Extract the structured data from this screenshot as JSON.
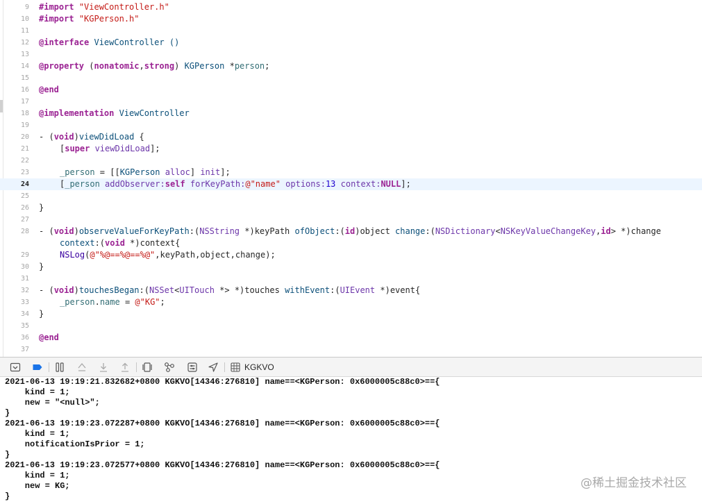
{
  "editor": {
    "lines": [
      {
        "num": "9",
        "indent": 0,
        "tokens": [
          {
            "t": "#import ",
            "c": "kw"
          },
          {
            "t": "\"ViewController.h\"",
            "c": "str"
          }
        ]
      },
      {
        "num": "10",
        "indent": 0,
        "tokens": [
          {
            "t": "#import ",
            "c": "kw"
          },
          {
            "t": "\"KGPerson.h\"",
            "c": "str"
          }
        ]
      },
      {
        "num": "11",
        "indent": 0,
        "tokens": []
      },
      {
        "num": "12",
        "indent": 0,
        "tokens": [
          {
            "t": "@interface",
            "c": "kw"
          },
          {
            "t": " ViewController ()",
            "c": "type"
          }
        ]
      },
      {
        "num": "13",
        "indent": 0,
        "tokens": []
      },
      {
        "num": "14",
        "indent": 0,
        "tokens": [
          {
            "t": "@property",
            "c": "kw"
          },
          {
            "t": " (",
            "c": "pl"
          },
          {
            "t": "nonatomic",
            "c": "kw"
          },
          {
            "t": ",",
            "c": "pl"
          },
          {
            "t": "strong",
            "c": "kw"
          },
          {
            "t": ") ",
            "c": "pl"
          },
          {
            "t": "KGPerson",
            "c": "type"
          },
          {
            "t": " *",
            "c": "pl"
          },
          {
            "t": "person",
            "c": "prop"
          },
          {
            "t": ";",
            "c": "pl"
          }
        ]
      },
      {
        "num": "15",
        "indent": 0,
        "tokens": []
      },
      {
        "num": "16",
        "indent": 0,
        "tokens": [
          {
            "t": "@end",
            "c": "kw"
          }
        ]
      },
      {
        "num": "17",
        "indent": 0,
        "tokens": []
      },
      {
        "num": "18",
        "indent": 0,
        "tokens": [
          {
            "t": "@implementation",
            "c": "kw"
          },
          {
            "t": " ViewController",
            "c": "type"
          }
        ]
      },
      {
        "num": "19",
        "indent": 0,
        "tokens": []
      },
      {
        "num": "20",
        "indent": 0,
        "tokens": [
          {
            "t": "- (",
            "c": "pl"
          },
          {
            "t": "void",
            "c": "kw"
          },
          {
            "t": ")",
            "c": "pl"
          },
          {
            "t": "viewDidLoad",
            "c": "type"
          },
          {
            "t": " {",
            "c": "pl"
          }
        ]
      },
      {
        "num": "21",
        "indent": 1,
        "tokens": [
          {
            "t": "[",
            "c": "pl"
          },
          {
            "t": "super",
            "c": "kw"
          },
          {
            "t": " viewDidLoad",
            "c": "meth"
          },
          {
            "t": "];",
            "c": "pl"
          }
        ]
      },
      {
        "num": "22",
        "indent": 0,
        "tokens": []
      },
      {
        "num": "23",
        "indent": 1,
        "tokens": [
          {
            "t": "_person",
            "c": "prop"
          },
          {
            "t": " = [[",
            "c": "pl"
          },
          {
            "t": "KGPerson",
            "c": "type"
          },
          {
            "t": " alloc",
            "c": "meth"
          },
          {
            "t": "] ",
            "c": "pl"
          },
          {
            "t": "init",
            "c": "meth"
          },
          {
            "t": "];",
            "c": "pl"
          }
        ]
      },
      {
        "num": "24",
        "indent": 1,
        "current": true,
        "tokens": [
          {
            "t": "[",
            "c": "pl"
          },
          {
            "t": "_person",
            "c": "prop"
          },
          {
            "t": " addObserver:",
            "c": "meth"
          },
          {
            "t": "self",
            "c": "kw"
          },
          {
            "t": " forKeyPath:",
            "c": "meth"
          },
          {
            "t": "@\"name\"",
            "c": "str"
          },
          {
            "t": " options:",
            "c": "meth"
          },
          {
            "t": "13",
            "c": "num"
          },
          {
            "t": " context:",
            "c": "meth"
          },
          {
            "t": "NULL",
            "c": "kw"
          },
          {
            "t": "];",
            "c": "pl"
          }
        ]
      },
      {
        "num": "25",
        "indent": 0,
        "tokens": []
      },
      {
        "num": "26",
        "indent": 0,
        "tokens": [
          {
            "t": "}",
            "c": "pl"
          }
        ]
      },
      {
        "num": "27",
        "indent": 0,
        "tokens": []
      },
      {
        "num": "28",
        "indent": 0,
        "tokens": [
          {
            "t": "- (",
            "c": "pl"
          },
          {
            "t": "void",
            "c": "kw"
          },
          {
            "t": ")",
            "c": "pl"
          },
          {
            "t": "observeValueForKeyPath",
            "c": "type"
          },
          {
            "t": ":(",
            "c": "pl"
          },
          {
            "t": "NSString",
            "c": "meth"
          },
          {
            "t": " *)keyPath ",
            "c": "pl"
          },
          {
            "t": "ofObject",
            "c": "type"
          },
          {
            "t": ":(",
            "c": "pl"
          },
          {
            "t": "id",
            "c": "kw"
          },
          {
            "t": ")object ",
            "c": "pl"
          },
          {
            "t": "change",
            "c": "type"
          },
          {
            "t": ":(",
            "c": "pl"
          },
          {
            "t": "NSDictionary",
            "c": "meth"
          },
          {
            "t": "<",
            "c": "pl"
          },
          {
            "t": "NSKeyValueChangeKey",
            "c": "meth"
          },
          {
            "t": ",",
            "c": "pl"
          },
          {
            "t": "id",
            "c": "kw"
          },
          {
            "t": "> *)change",
            "c": "pl"
          }
        ]
      },
      {
        "num": "",
        "indent": 1,
        "tokens": [
          {
            "t": "context",
            "c": "type"
          },
          {
            "t": ":(",
            "c": "pl"
          },
          {
            "t": "void",
            "c": "kw"
          },
          {
            "t": " *)context{",
            "c": "pl"
          }
        ]
      },
      {
        "num": "29",
        "indent": 1,
        "tokens": [
          {
            "t": "NSLog",
            "c": "nsl"
          },
          {
            "t": "(",
            "c": "pl"
          },
          {
            "t": "@\"%@==%@==%@\"",
            "c": "str"
          },
          {
            "t": ",keyPath,object,change);",
            "c": "pl"
          }
        ]
      },
      {
        "num": "30",
        "indent": 0,
        "tokens": [
          {
            "t": "}",
            "c": "pl"
          }
        ]
      },
      {
        "num": "31",
        "indent": 0,
        "tokens": []
      },
      {
        "num": "32",
        "indent": 0,
        "tokens": [
          {
            "t": "- (",
            "c": "pl"
          },
          {
            "t": "void",
            "c": "kw"
          },
          {
            "t": ")",
            "c": "pl"
          },
          {
            "t": "touchesBegan",
            "c": "type"
          },
          {
            "t": ":(",
            "c": "pl"
          },
          {
            "t": "NSSet",
            "c": "meth"
          },
          {
            "t": "<",
            "c": "pl"
          },
          {
            "t": "UITouch",
            "c": "meth"
          },
          {
            "t": " *> *)touches ",
            "c": "pl"
          },
          {
            "t": "withEvent",
            "c": "type"
          },
          {
            "t": ":(",
            "c": "pl"
          },
          {
            "t": "UIEvent",
            "c": "meth"
          },
          {
            "t": " *)event{",
            "c": "pl"
          }
        ]
      },
      {
        "num": "33",
        "indent": 1,
        "tokens": [
          {
            "t": "_person",
            "c": "prop"
          },
          {
            "t": ".",
            "c": "pl"
          },
          {
            "t": "name",
            "c": "prop"
          },
          {
            "t": " = ",
            "c": "pl"
          },
          {
            "t": "@\"KG\"",
            "c": "str"
          },
          {
            "t": ";",
            "c": "pl"
          }
        ]
      },
      {
        "num": "34",
        "indent": 0,
        "tokens": [
          {
            "t": "}",
            "c": "pl"
          }
        ]
      },
      {
        "num": "35",
        "indent": 0,
        "tokens": []
      },
      {
        "num": "36",
        "indent": 0,
        "tokens": [
          {
            "t": "@end",
            "c": "kw"
          }
        ]
      },
      {
        "num": "37",
        "indent": 0,
        "tokens": []
      }
    ]
  },
  "debug_bar": {
    "process_label": "KGKVO",
    "buttons": [
      "hide-debug-area-icon",
      "breakpoints-toggle-icon",
      "pause-icon",
      "step-over-icon",
      "step-into-icon",
      "step-out-icon",
      "view-debugger-icon",
      "memory-graph-icon",
      "environment-overrides-icon",
      "simulate-location-icon",
      "process-icon"
    ]
  },
  "console": {
    "lines": [
      "2021-06-13 19:19:21.832682+0800 KGKVO[14346:276810] name==<KGPerson: 0x6000005c88c0>=={",
      "    kind = 1;",
      "    new = \"<null>\";",
      "}",
      "2021-06-13 19:19:23.072287+0800 KGKVO[14346:276810] name==<KGPerson: 0x6000005c88c0>=={",
      "    kind = 1;",
      "    notificationIsPrior = 1;",
      "}",
      "2021-06-13 19:19:23.072577+0800 KGKVO[14346:276810] name==<KGPerson: 0x6000005c88c0>=={",
      "    kind = 1;",
      "    new = KG;",
      "}"
    ]
  },
  "watermark": "@稀土掘金技术社区"
}
